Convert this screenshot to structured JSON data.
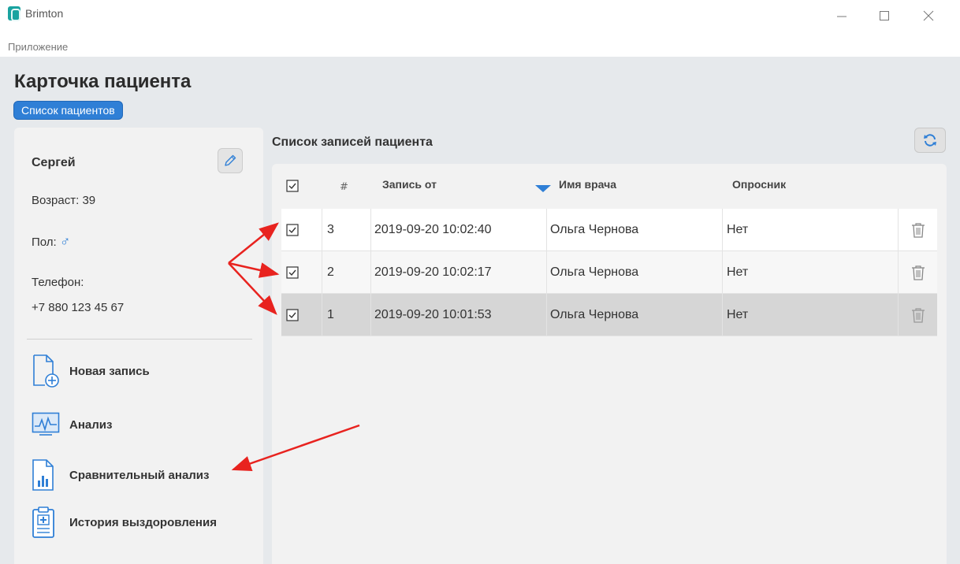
{
  "window": {
    "title": "Brimton",
    "menu_item": "Приложение"
  },
  "page": {
    "title": "Карточка пациента",
    "breadcrumb": "Список пациентов"
  },
  "patient": {
    "name": "Сергей",
    "age_label": "Возраст:",
    "age_value": "39",
    "sex_label": "Пол:",
    "sex_symbol": "♂",
    "phone_label": "Телефон:",
    "phone_value": "+7 880 123 45 67"
  },
  "actions": [
    {
      "label": "Новая запись",
      "icon": "new-document-icon"
    },
    {
      "label": "Анализ",
      "icon": "monitor-chart-icon"
    },
    {
      "label": "Сравнительный анализ",
      "icon": "document-bar-chart-icon"
    },
    {
      "label": "История выздоровления",
      "icon": "clipboard-medical-icon"
    }
  ],
  "records": {
    "title": "Список записей пациента",
    "columns": {
      "num": "#",
      "date": "Запись от",
      "doctor": "Имя врача",
      "survey": "Опросник"
    },
    "rows": [
      {
        "num": "3",
        "date": "2019-09-20 10:02:40",
        "doctor": "Ольга Чернова",
        "survey": "Нет",
        "checked": true
      },
      {
        "num": "2",
        "date": "2019-09-20 10:02:17",
        "doctor": "Ольга Чернова",
        "survey": "Нет",
        "checked": true
      },
      {
        "num": "1",
        "date": "2019-09-20 10:01:53",
        "doctor": "Ольга Чернова",
        "survey": "Нет",
        "checked": true,
        "selected": true
      }
    ]
  },
  "colors": {
    "accent": "#2f7fd6",
    "annotation": "#e8231f"
  }
}
